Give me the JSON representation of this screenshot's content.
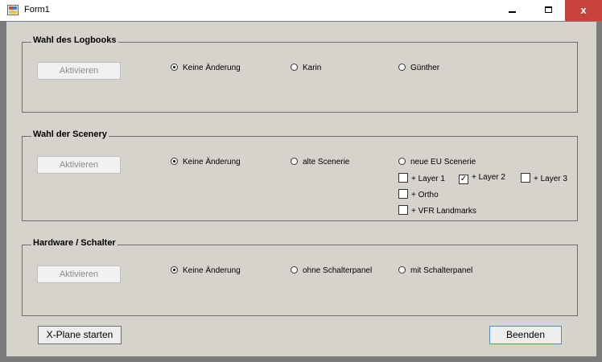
{
  "window": {
    "title": "Form1",
    "minimize_glyph": "",
    "maximize_glyph": "",
    "close_glyph": "x"
  },
  "groups": {
    "logbook": {
      "label": "Wahl des Logbooks",
      "activate_label": "Aktivieren",
      "options": [
        "Keine Änderung",
        "Karin",
        "Günther"
      ],
      "selected": "Keine Änderung"
    },
    "scenery": {
      "label": "Wahl der Scenery",
      "activate_label": "Aktivieren",
      "options": [
        "Keine Änderung",
        "alte Scenerie",
        "neue EU Scenerie"
      ],
      "selected": "Keine Änderung",
      "layers": [
        {
          "label": "+ Layer 1",
          "checked": false
        },
        {
          "label": "+ Layer 2",
          "checked": true
        },
        {
          "label": "+ Layer 3",
          "checked": false
        },
        {
          "label": "+ Ortho",
          "checked": false
        },
        {
          "label": "+ VFR Landmarks",
          "checked": false
        }
      ]
    },
    "hardware": {
      "label": "Hardware / Schalter",
      "activate_label": "Aktivieren",
      "options": [
        "Keine Änderung",
        "ohne Schalterpanel",
        "mit Schalterpanel"
      ],
      "selected": "Keine Änderung"
    }
  },
  "footer": {
    "start_label": "X-Plane starten",
    "end_label": "Beenden"
  },
  "icons": {
    "app": "form-icon",
    "check_mark": "✓"
  }
}
